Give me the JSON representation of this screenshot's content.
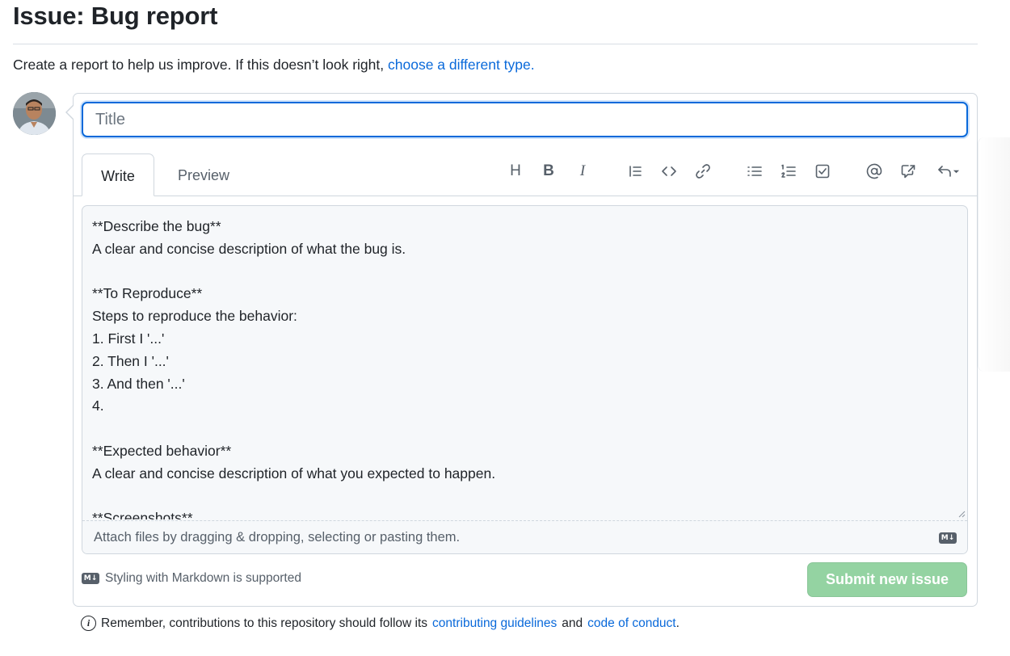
{
  "page": {
    "title": "Issue: Bug report",
    "intro_text": "Create a report to help us improve. If this doesn’t look right,",
    "intro_link": "choose a different type."
  },
  "form": {
    "title_placeholder": "Title",
    "title_value": "",
    "tabs": [
      {
        "label": "Write",
        "active": true
      },
      {
        "label": "Preview",
        "active": false
      }
    ],
    "toolbar": [
      {
        "name": "heading-icon",
        "glyph": "H"
      },
      {
        "name": "bold-icon",
        "glyph": "B"
      },
      {
        "name": "italic-icon",
        "glyph": "I"
      },
      {
        "name": "quote-icon"
      },
      {
        "name": "code-icon"
      },
      {
        "name": "link-icon"
      },
      {
        "name": "unordered-list-icon"
      },
      {
        "name": "ordered-list-icon"
      },
      {
        "name": "task-list-icon"
      },
      {
        "name": "mention-icon"
      },
      {
        "name": "cross-reference-icon"
      },
      {
        "name": "saved-replies-icon"
      }
    ],
    "body_text": "**Describe the bug**\nA clear and concise description of what the bug is.\n\n**To Reproduce**\nSteps to reproduce the behavior:\n1. First I '...'\n2. Then I '...'\n3. And then '...'\n4.\n\n**Expected behavior**\nA clear and concise description of what you expected to happen.\n\n**Screenshots**\nIf applicable, add screenshots to help explain your problem.",
    "attach_text": "Attach files by dragging & dropping, selecting or pasting them.",
    "markdown_badge": "M↓",
    "markdown_note": "Styling with Markdown is supported",
    "submit_label": "Submit new issue"
  },
  "footer": {
    "prefix": "Remember, contributions to this repository should follow its",
    "guidelines_link": "contributing guidelines",
    "and_text": "and",
    "conduct_link": "code of conduct",
    "suffix": "."
  },
  "colors": {
    "accent": "#0969da",
    "submit_disabled": "#94d3a2",
    "border": "#d0d7de",
    "muted_text": "#57606a"
  }
}
